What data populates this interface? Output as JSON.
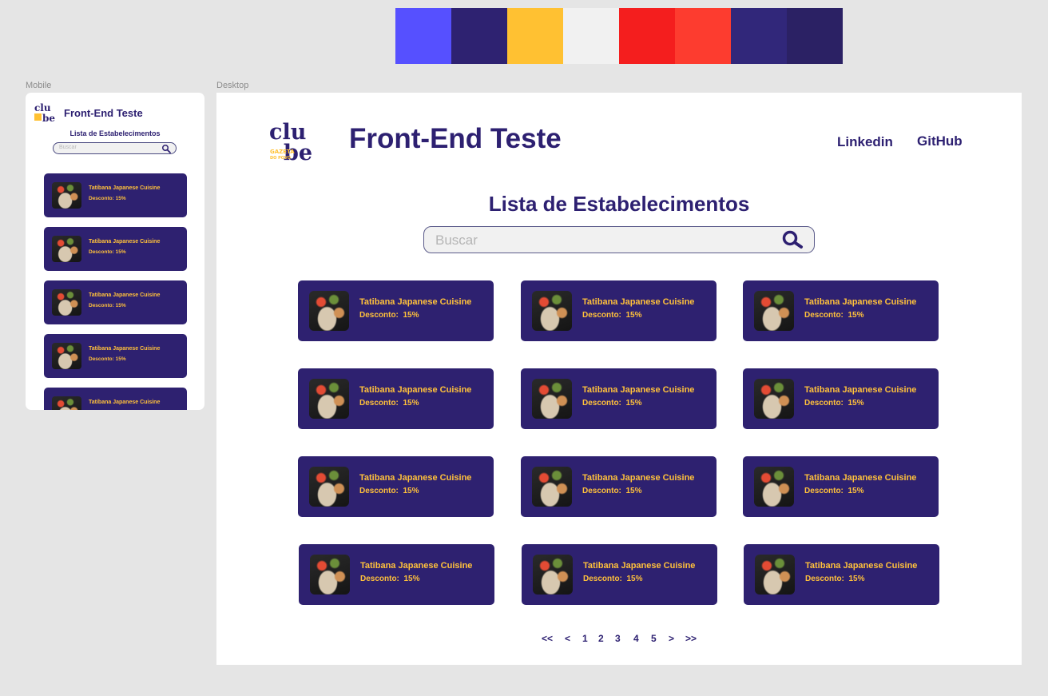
{
  "palette": [
    "#5650ff",
    "#2e2271",
    "#ffc132",
    "#f1f1f1",
    "#f41e1e",
    "#fd3c2f",
    "#31277a",
    "#2b2164"
  ],
  "labels": {
    "mobile": "Mobile",
    "desktop": "Desktop"
  },
  "app": {
    "title": "Front-End Teste",
    "list_title": "Lista de Estabelecimentos"
  },
  "logo": {
    "top": "clu",
    "bottom": "be",
    "sub1": "GAZETA",
    "sub2": "DO POVO"
  },
  "nav": {
    "linkedin": "Linkedin",
    "github": "GitHub"
  },
  "search": {
    "placeholder": "Buscar",
    "value": ""
  },
  "establishments": [
    {
      "name": "Tatibana Japanese Cuisine",
      "discount_label": "Desconto:",
      "discount": "15%"
    },
    {
      "name": "Tatibana Japanese Cuisine",
      "discount_label": "Desconto:",
      "discount": "15%"
    },
    {
      "name": "Tatibana Japanese Cuisine",
      "discount_label": "Desconto:",
      "discount": "15%"
    },
    {
      "name": "Tatibana Japanese Cuisine",
      "discount_label": "Desconto:",
      "discount": "15%"
    },
    {
      "name": "Tatibana Japanese Cuisine",
      "discount_label": "Desconto:",
      "discount": "15%"
    },
    {
      "name": "Tatibana Japanese Cuisine",
      "discount_label": "Desconto:",
      "discount": "15%"
    },
    {
      "name": "Tatibana Japanese Cuisine",
      "discount_label": "Desconto:",
      "discount": "15%"
    },
    {
      "name": "Tatibana Japanese Cuisine",
      "discount_label": "Desconto:",
      "discount": "15%"
    },
    {
      "name": "Tatibana Japanese Cuisine",
      "discount_label": "Desconto:",
      "discount": "15%"
    },
    {
      "name": "Tatibana Japanese Cuisine",
      "discount_label": "Desconto:",
      "discount": "15%"
    },
    {
      "name": "Tatibana Japanese Cuisine",
      "discount_label": "Desconto:",
      "discount": "15%"
    },
    {
      "name": "Tatibana Japanese Cuisine",
      "discount_label": "Desconto:",
      "discount": "15%"
    }
  ],
  "mobile_establishments": [
    {
      "name": "Tatibana Japanese Cuisine",
      "discount_label": "Desconto:",
      "discount": "15%"
    },
    {
      "name": "Tatibana Japanese Cuisine",
      "discount_label": "Desconto:",
      "discount": "15%"
    },
    {
      "name": "Tatibana Japanese Cuisine",
      "discount_label": "Desconto:",
      "discount": "15%"
    },
    {
      "name": "Tatibana Japanese Cuisine",
      "discount_label": "Desconto:",
      "discount": "15%"
    },
    {
      "name": "Tatibana Japanese Cuisine"
    }
  ],
  "pagination": [
    "<<",
    "<",
    "1",
    "2",
    "3",
    "4",
    "5",
    ">",
    ">>"
  ]
}
